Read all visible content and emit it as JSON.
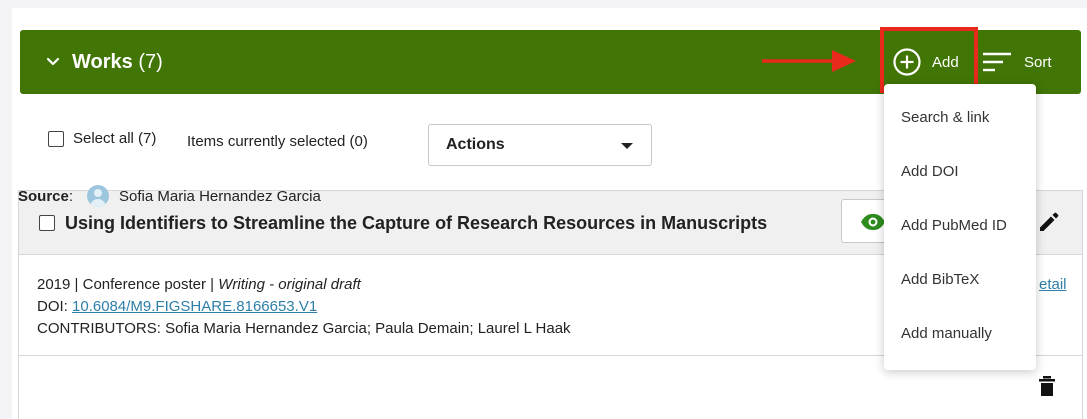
{
  "works_section": {
    "title": "Works",
    "count": "(7)",
    "add_label": "Add",
    "sort_label": "Sort"
  },
  "selection": {
    "select_all_label": "Select all (7)",
    "selected_label": "Items currently selected (0)",
    "actions_label": "Actions"
  },
  "add_menu": {
    "items": [
      "Search & link",
      "Add DOI",
      "Add PubMed ID",
      "Add BibTeX",
      "Add manually"
    ]
  },
  "work": {
    "title": "Using Identifiers to Streamline the Capture of Research Resources in Manuscripts",
    "year": "2019",
    "separator": " | ",
    "type": "Conference poster",
    "role": "Writing - original draft",
    "doi_label": "DOI: ",
    "doi": "10.6084/M9.FIGSHARE.8166653.V1",
    "contributors": "CONTRIBUTORS: Sofia Maria Hernandez Garcia; Paula Demain; Laurel L Haak",
    "detail_link": "etail",
    "source_label": "Source",
    "source_colon": ":",
    "source_name": "Sofia Maria Hernandez Garcia"
  },
  "colors": {
    "header_green": "#417505",
    "highlight_red": "#e8291b",
    "visibility_green": "#2e8b1e",
    "link_blue": "#2e7fa8"
  },
  "icons": [
    "chevron-down-icon",
    "arrow-right-icon",
    "plus-circle-icon",
    "sort-icon",
    "eye-icon",
    "pencil-icon",
    "avatar-icon",
    "trash-icon"
  ]
}
